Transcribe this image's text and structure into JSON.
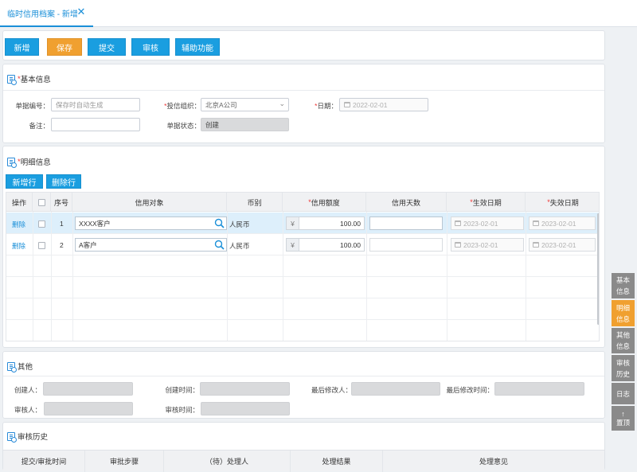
{
  "tabs": [
    {
      "label": "临时信用档案 - 新增"
    }
  ],
  "toolbar": {
    "add": "新增",
    "save": "保存",
    "submit": "提交",
    "audit": "审核",
    "aux": "辅助功能"
  },
  "basic": {
    "title": "基本信息",
    "doc_no_label": "单据编号：",
    "doc_no_placeholder": "保存时自动生成",
    "org_label": "投信组织：",
    "org_value": "北京A公司",
    "date_label": "日期：",
    "date_value": "2022-02-01",
    "remark_label": "备注：",
    "remark_value": "",
    "status_label": "单据状态：",
    "status_value": "创建"
  },
  "detail": {
    "title": "明细信息",
    "add_row": "新增行",
    "del_row": "删除行",
    "headers": {
      "op": "操作",
      "seq": "序号",
      "target": "信用对象",
      "currency": "币别",
      "amount": "信用额度",
      "days": "信用天数",
      "start": "生效日期",
      "end": "失效日期"
    },
    "rows": [
      {
        "op": "删除",
        "seq": "1",
        "target": "XXXX客户",
        "currency": "人民币",
        "symbol": "¥",
        "amount": "100.00",
        "start": "2023-02-01",
        "end": "2023-02-01"
      },
      {
        "op": "删除",
        "seq": "2",
        "target": "A客户",
        "currency": "人民币",
        "symbol": "¥",
        "amount": "100.00",
        "start": "2023-02-01",
        "end": "2023-02-01"
      }
    ]
  },
  "other": {
    "title": "其他",
    "creator_label": "创建人：",
    "created_time_label": "创建时间：",
    "modifier_label": "最后修改人：",
    "modified_time_label": "最后修改时间：",
    "auditor_label": "审核人：",
    "audit_time_label": "审核时间："
  },
  "history": {
    "title": "审核历史",
    "headers": [
      "提交/审批时间",
      "审批步骤",
      "（待）处理人",
      "处理结果",
      "处理意见"
    ]
  },
  "side_nav": [
    "基本信息",
    "明细信息",
    "其他信息",
    "审核历史",
    "日志",
    "置顶"
  ],
  "colors": {
    "primary": "#1a9ee0",
    "save": "#f0a030",
    "side_active": "#f0a030",
    "side": "#8a8a8a"
  }
}
